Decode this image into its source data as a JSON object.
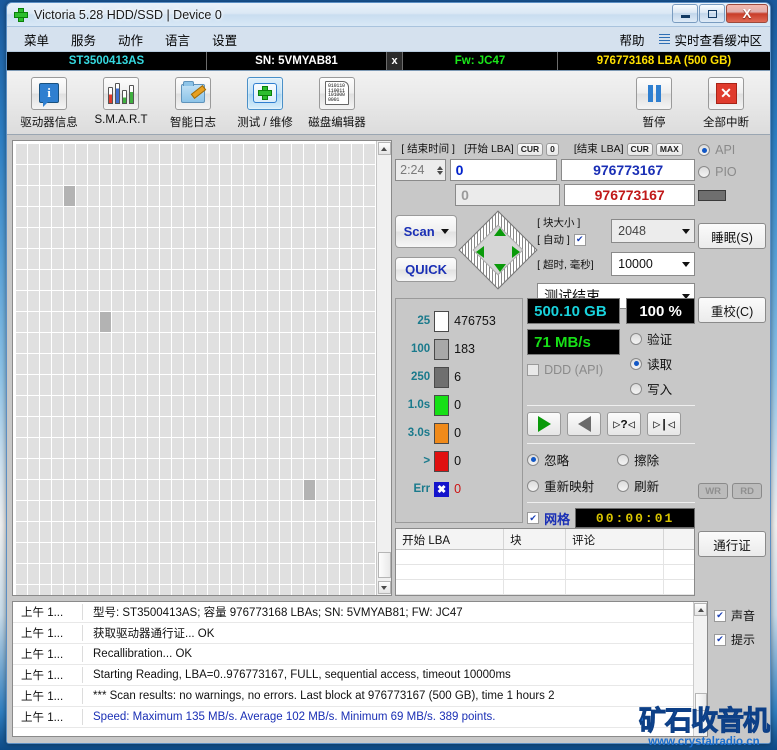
{
  "window": {
    "title": "Victoria 5.28 HDD/SSD | Device 0",
    "minimize": "–",
    "maximize": "□",
    "close": "X"
  },
  "menu": {
    "items": [
      {
        "label": "菜单"
      },
      {
        "label": "服务"
      },
      {
        "label": "动作"
      },
      {
        "label": "语言"
      },
      {
        "label": "设置"
      }
    ],
    "help": "帮助",
    "buffer_view": "实时查看缓冲区"
  },
  "drive_info": {
    "model": "ST3500413AS",
    "serial": "SN: 5VMYAB81",
    "x_label": "x",
    "firmware": "Fw: JC47",
    "capacity": "976773168 LBA (500 GB)"
  },
  "toolbar": {
    "buttons": [
      {
        "label": "驱动器信息",
        "icon": "info-icon"
      },
      {
        "label": "S.M.A.R.T",
        "icon": "smart-chart-icon"
      },
      {
        "label": "智能日志",
        "icon": "log-folder-icon"
      },
      {
        "label": "测试 / 维修",
        "icon": "medkit-icon"
      },
      {
        "label": "磁盘编辑器",
        "icon": "disk-editor-icon"
      }
    ],
    "pause": {
      "label": "暂停",
      "icon": "pause-icon"
    },
    "stop_all": {
      "label": "全部中断",
      "icon": "stop-icon"
    },
    "disk_editor_glyph": "010110\n110011\n101000\n0001"
  },
  "controls": {
    "end_time_caption": "[ 结束时间 ]",
    "end_time_value": "2:24",
    "start_lba_caption": "[开始 LBA]",
    "start_lba_cur": "CUR",
    "start_lba_zero": "0",
    "start_lba_value": "0",
    "start_lba_value2": "0",
    "end_lba_caption": "[结束 LBA]",
    "end_lba_cur": "CUR",
    "end_lba_max": "MAX",
    "end_lba_value": "976773167",
    "end_lba_value2": "976773167",
    "scan_button": "Scan",
    "quick_button": "QUICK",
    "block_size_caption": "[ 块大小 ]",
    "auto_caption": "[ 自动 ]",
    "block_size_value": "2048",
    "timeout_caption": "[ 超时, 毫秒]",
    "timeout_value": "10000",
    "status_select": "测试结束"
  },
  "stats": {
    "rows": [
      {
        "label": "25",
        "value": "476753",
        "color": "#ffffff"
      },
      {
        "label": "100",
        "value": "183",
        "color": "#a8a8a8"
      },
      {
        "label": "250",
        "value": "6",
        "color": "#6f6f6f"
      },
      {
        "label": "1.0s",
        "value": "0",
        "color": "#16e016"
      },
      {
        "label": "3.0s",
        "value": "0",
        "color": "#f08a1a"
      },
      {
        "label": ">",
        "value": "0",
        "color": "#e01010"
      },
      {
        "label": "Err",
        "value": "0",
        "color": "#1414cc"
      }
    ]
  },
  "results": {
    "capacity_lcd": "500.10 GB",
    "percent_lcd": "100    %",
    "speed_lcd": "71 MB/s",
    "ddd_api": "DDD (API)",
    "modes": [
      {
        "label": "验证",
        "selected": false
      },
      {
        "label": "读取",
        "selected": true
      },
      {
        "label": "写入",
        "selected": false
      }
    ],
    "transport": [
      {
        "name": "play-icon",
        "glyph": ""
      },
      {
        "name": "rewind-icon",
        "glyph": ""
      },
      {
        "name": "seek-random-icon",
        "glyph": "▷?◁"
      },
      {
        "name": "seek-end-icon",
        "glyph": "▷|◁"
      }
    ],
    "actions": [
      {
        "label": "忽略",
        "selected": true
      },
      {
        "label": "擦除",
        "selected": false
      },
      {
        "label": "重新映射",
        "selected": false
      },
      {
        "label": "刷新",
        "selected": false
      }
    ],
    "grid_checkbox": "网格",
    "grid_checked": true,
    "timer": "00:00:01"
  },
  "defect_table": {
    "headers": [
      "开始 LBA",
      "块",
      "评论",
      ""
    ],
    "rows": []
  },
  "sidepanel": {
    "api_label": "API",
    "pio_label": "PIO",
    "api_selected": true,
    "pio_selected": false,
    "sleep_button": "睡眠(S)",
    "recal_button": "重校(C)",
    "wr_button": "WR",
    "rd_button": "RD",
    "passport_button": "通行证"
  },
  "log": {
    "lines": [
      {
        "time": "上午 1...",
        "text": "型号: ST3500413AS; 容量 976773168 LBAs; SN: 5VMYAB81; FW: JC47",
        "blue": false
      },
      {
        "time": "上午 1...",
        "text": "获取驱动器通行证... OK",
        "blue": false
      },
      {
        "time": "上午 1...",
        "text": "Recallibration... OK",
        "blue": false
      },
      {
        "time": "上午 1...",
        "text": "Starting Reading, LBA=0..976773167, FULL, sequential access, timeout 10000ms",
        "blue": false
      },
      {
        "time": "上午 1...",
        "text": "*** Scan results: no warnings, no errors. Last block at 976773167 (500 GB), time 1 hours 2",
        "blue": false
      },
      {
        "time": "上午 1...",
        "text": "Speed: Maximum 135 MB/s. Average 102 MB/s. Minimum 69 MB/s. 389 points.",
        "blue": true
      }
    ],
    "options": [
      {
        "label": "声音",
        "checked": true
      },
      {
        "label": "提示",
        "checked": true
      }
    ]
  },
  "watermark": {
    "logo": "矿石收音机",
    "url": "www.crystalradio.cn"
  }
}
